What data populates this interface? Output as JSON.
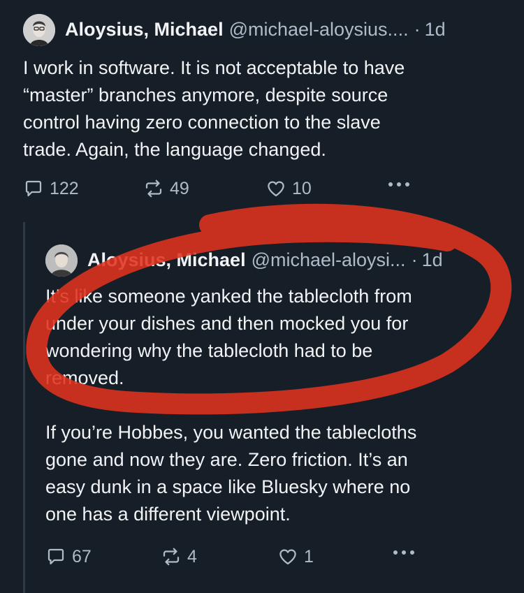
{
  "post1": {
    "author": "Aloysius, Michael",
    "handle": "@michael-aloysius....",
    "separator": "·",
    "time": "1d",
    "text": "I work in software. It is not acceptable to have\n“master” branches anymore, despite source\ncontrol having zero connection to the slave\ntrade. Again, the language changed.",
    "replies": "122",
    "reposts": "49",
    "likes": "10"
  },
  "post2": {
    "author": "Aloysius, Michael",
    "handle": "@michael-aloysi...",
    "separator": "·",
    "time": "1d",
    "text": "It’s like someone yanked the tablecloth from\nunder your dishes and then mocked you for\nwondering why the tablecloth had to be\nremoved.\n\nIf you’re Hobbes, you wanted the tablecloths\ngone and now they are. Zero friction. It’s an\neasy dunk in a space like Bluesky where no\none has a different viewpoint.",
    "replies": "67",
    "reposts": "4",
    "likes": "1"
  },
  "colors": {
    "background": "#161e27",
    "text": "#f1f3f5",
    "muted": "#aebbc9",
    "annotation": "#e0321f"
  },
  "icons": [
    "avatar-photo",
    "reply-icon",
    "repost-icon",
    "like-icon",
    "more-icon"
  ]
}
